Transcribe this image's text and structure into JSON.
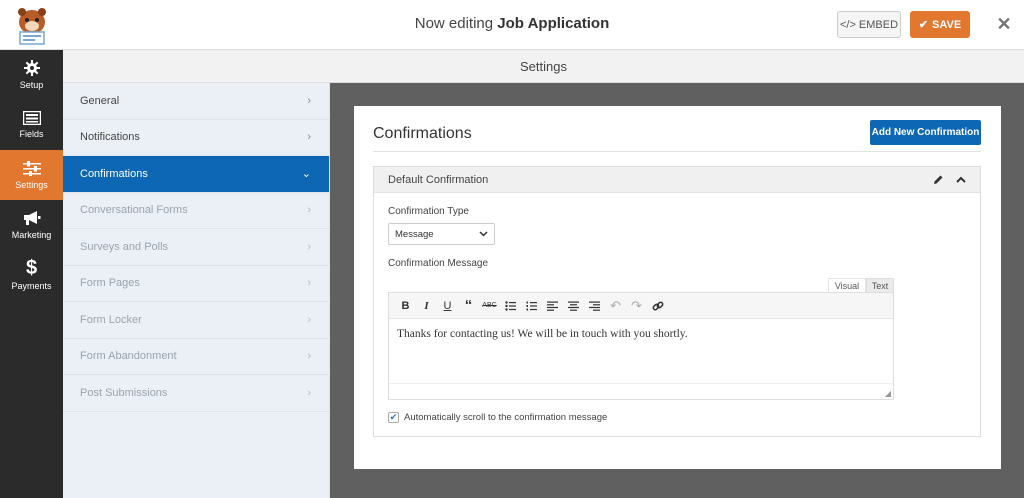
{
  "header": {
    "title_prefix": "Now editing",
    "title_form": "Job Application",
    "embed_label": "EMBED",
    "save_label": "SAVE",
    "close_label": "✕"
  },
  "iconbar": [
    {
      "label": "Setup",
      "icon": "gear-icon"
    },
    {
      "label": "Fields",
      "icon": "fields-icon"
    },
    {
      "label": "Settings",
      "icon": "sliders-icon",
      "active": true
    },
    {
      "label": "Marketing",
      "icon": "megaphone-icon"
    },
    {
      "label": "Payments",
      "icon": "dollar-icon"
    }
  ],
  "settings_header": "Settings",
  "nav": [
    {
      "label": "General"
    },
    {
      "label": "Notifications"
    },
    {
      "label": "Confirmations",
      "active": true
    },
    {
      "label": "Conversational Forms",
      "muted": true
    },
    {
      "label": "Surveys and Polls",
      "muted": true
    },
    {
      "label": "Form Pages",
      "muted": true
    },
    {
      "label": "Form Locker",
      "muted": true
    },
    {
      "label": "Form Abandonment",
      "muted": true
    },
    {
      "label": "Post Submissions",
      "muted": true
    }
  ],
  "panel": {
    "title": "Confirmations",
    "add_button": "Add New Confirmation",
    "box_title": "Default Confirmation",
    "type_label": "Confirmation Type",
    "type_value": "Message",
    "message_label": "Confirmation Message",
    "tab_visual": "Visual",
    "tab_text": "Text",
    "message_text": "Thanks for contacting us! We will be in touch with you shortly.",
    "checkbox_label": "Automatically scroll to the confirmation message",
    "checkbox_checked": true
  },
  "colors": {
    "accent_orange": "#e27730",
    "accent_blue": "#0e67b4",
    "sidebar_dark": "#2b2b2b"
  }
}
